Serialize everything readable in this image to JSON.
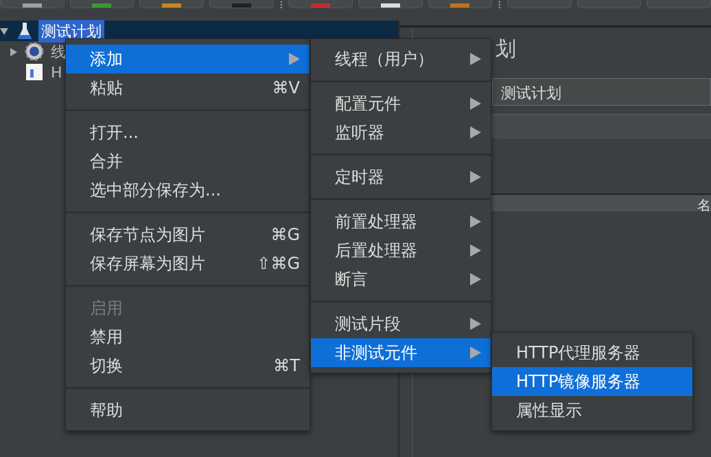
{
  "tree": [
    {
      "label": "测试计划",
      "selected": true,
      "expanded": true,
      "kind": "plan",
      "children": [
        {
          "label": "线",
          "selected": false,
          "expanded": false,
          "kind": "gear"
        },
        {
          "label": "H",
          "selected": false,
          "kind": "sheet"
        }
      ]
    }
  ],
  "panel": {
    "title": "划",
    "name_value": "测试计划",
    "table_header": "名"
  },
  "context_menu": {
    "groups": [
      {
        "items": [
          {
            "label": "添加",
            "has_submenu": true,
            "selected": true,
            "disabled": false
          },
          {
            "label": "粘贴",
            "shortcut": "⌘V",
            "has_submenu": false,
            "selected": false,
            "disabled": false
          }
        ]
      },
      {
        "items": [
          {
            "label": "打开...",
            "has_submenu": false,
            "selected": false,
            "disabled": false
          },
          {
            "label": "合并",
            "has_submenu": false,
            "selected": false,
            "disabled": false
          },
          {
            "label": "选中部分保存为...",
            "has_submenu": false,
            "selected": false,
            "disabled": false
          }
        ]
      },
      {
        "items": [
          {
            "label": "保存节点为图片",
            "shortcut": "⌘G",
            "has_submenu": false,
            "selected": false,
            "disabled": false
          },
          {
            "label": "保存屏幕为图片",
            "shortcut": "⇧⌘G",
            "has_submenu": false,
            "selected": false,
            "disabled": false
          }
        ]
      },
      {
        "items": [
          {
            "label": "启用",
            "has_submenu": false,
            "selected": false,
            "disabled": true
          },
          {
            "label": "禁用",
            "has_submenu": false,
            "selected": false,
            "disabled": false
          },
          {
            "label": "切换",
            "shortcut": "⌘T",
            "has_submenu": false,
            "selected": false,
            "disabled": false
          }
        ]
      },
      {
        "items": [
          {
            "label": "帮助",
            "has_submenu": false,
            "selected": false,
            "disabled": false
          }
        ]
      }
    ]
  },
  "add_submenu": {
    "groups": [
      {
        "items": [
          {
            "label": "线程（用户）",
            "has_submenu": true,
            "selected": false
          }
        ]
      },
      {
        "items": [
          {
            "label": "配置元件",
            "has_submenu": true,
            "selected": false
          },
          {
            "label": "监听器",
            "has_submenu": true,
            "selected": false
          }
        ]
      },
      {
        "items": [
          {
            "label": "定时器",
            "has_submenu": true,
            "selected": false
          }
        ]
      },
      {
        "items": [
          {
            "label": "前置处理器",
            "has_submenu": true,
            "selected": false
          },
          {
            "label": "后置处理器",
            "has_submenu": true,
            "selected": false
          },
          {
            "label": "断言",
            "has_submenu": true,
            "selected": false
          }
        ]
      },
      {
        "items": [
          {
            "label": "测试片段",
            "has_submenu": true,
            "selected": false
          },
          {
            "label": "非测试元件",
            "has_submenu": true,
            "selected": true
          }
        ]
      }
    ]
  },
  "non_test_submenu": {
    "groups": [
      {
        "items": [
          {
            "label": "HTTP代理服务器",
            "has_submenu": false,
            "selected": false
          },
          {
            "label": "HTTP镜像服务器",
            "has_submenu": false,
            "selected": true
          },
          {
            "label": "属性显示",
            "has_submenu": false,
            "selected": false
          }
        ]
      }
    ]
  }
}
